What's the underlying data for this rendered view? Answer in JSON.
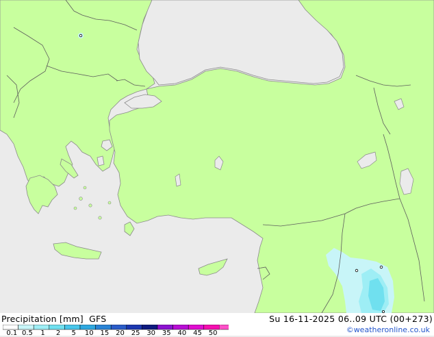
{
  "product": {
    "title": "Precipitation [mm]",
    "model": "GFS",
    "datetime": "Su 16-11-2025 06..09 UTC (00+273)",
    "credit": "©weatheronline.co.uk"
  },
  "legend": {
    "labels": [
      "0.1",
      "0.5",
      "1",
      "2",
      "5",
      "10",
      "15",
      "20",
      "25",
      "30",
      "35",
      "40",
      "45",
      "50"
    ],
    "colors": [
      "#ffffff",
      "#c8f5f8",
      "#9eeef5",
      "#70e0ef",
      "#48c6ea",
      "#2ea8e0",
      "#2a84d6",
      "#2b5cc8",
      "#1c37b0",
      "#0f1a80",
      "#8c12d0",
      "#b80ed4",
      "#e00ed0",
      "#f50fb0",
      "#ff50c8"
    ]
  },
  "colors": {
    "land": "#c8ff9e",
    "sea": "#ebebeb",
    "coast": "#8a8a8a",
    "border": "#5c5c5c",
    "precip_light": "#c8f5f8",
    "precip_mid": "#9eeef5",
    "precip_heavy": "#70e0ef"
  }
}
